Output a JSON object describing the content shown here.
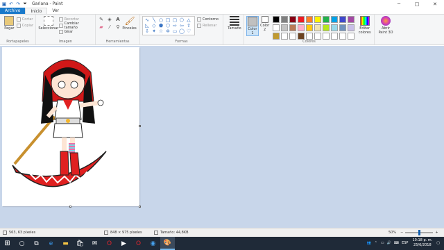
{
  "window": {
    "title": "Gariana - Paint",
    "controls": [
      "─",
      "□",
      "✕"
    ]
  },
  "menu": {
    "file": "Archivo",
    "tabs": [
      "Inicio",
      "Ver"
    ]
  },
  "ribbon": {
    "clipboard": {
      "label": "Portapapeles",
      "paste": "Pegar",
      "cut": "Cortar",
      "copy": "Copiar"
    },
    "image": {
      "label": "Imagen",
      "select": "Seleccionar",
      "crop": "Recortar",
      "resize": "Cambiar tamaño",
      "rotate": "Girar"
    },
    "tools": {
      "label": "Herramientas",
      "brushes": "Pinceles"
    },
    "shapes": {
      "label": "Formas",
      "outline": "Contorno",
      "fill": "Rellenar",
      "size": "Tamaño"
    },
    "colors": {
      "label": "Colores",
      "color1": "Color 1",
      "color2": "Color 2",
      "edit": "Editar colores",
      "paint3d": "Abrir Paint 3D",
      "color1_value": "#c0c0c0",
      "color2_value": "#ffffff",
      "palette": [
        "#000000",
        "#7f7f7f",
        "#880015",
        "#ed1c24",
        "#ff7f27",
        "#fff200",
        "#22b14c",
        "#00a2e8",
        "#3f48cc",
        "#a349a4",
        "#ffffff",
        "#c3c3c3",
        "#b97a57",
        "#ffaec9",
        "#ffc90e",
        "#efe4b0",
        "#b5e61d",
        "#99d9ea",
        "#7092be",
        "#c8bfe7",
        "#c09a30",
        "#ffffff",
        "#ffffff",
        "#6b4220",
        "#ffffff",
        "#ffffff",
        "#ffffff",
        "#ffffff",
        "#ffffff",
        "#ffffff"
      ]
    }
  },
  "status": {
    "cursor_pos": "563, 63 píxeles",
    "dimensions": "848 × 975 píxeles",
    "file_size": "Tamaño: 44,8KB",
    "zoom": "50%",
    "zoom_level": 0.5
  },
  "taskbar": {
    "lang": "ESP",
    "time": "10:18 p. m.",
    "date": "25/6/2018"
  }
}
